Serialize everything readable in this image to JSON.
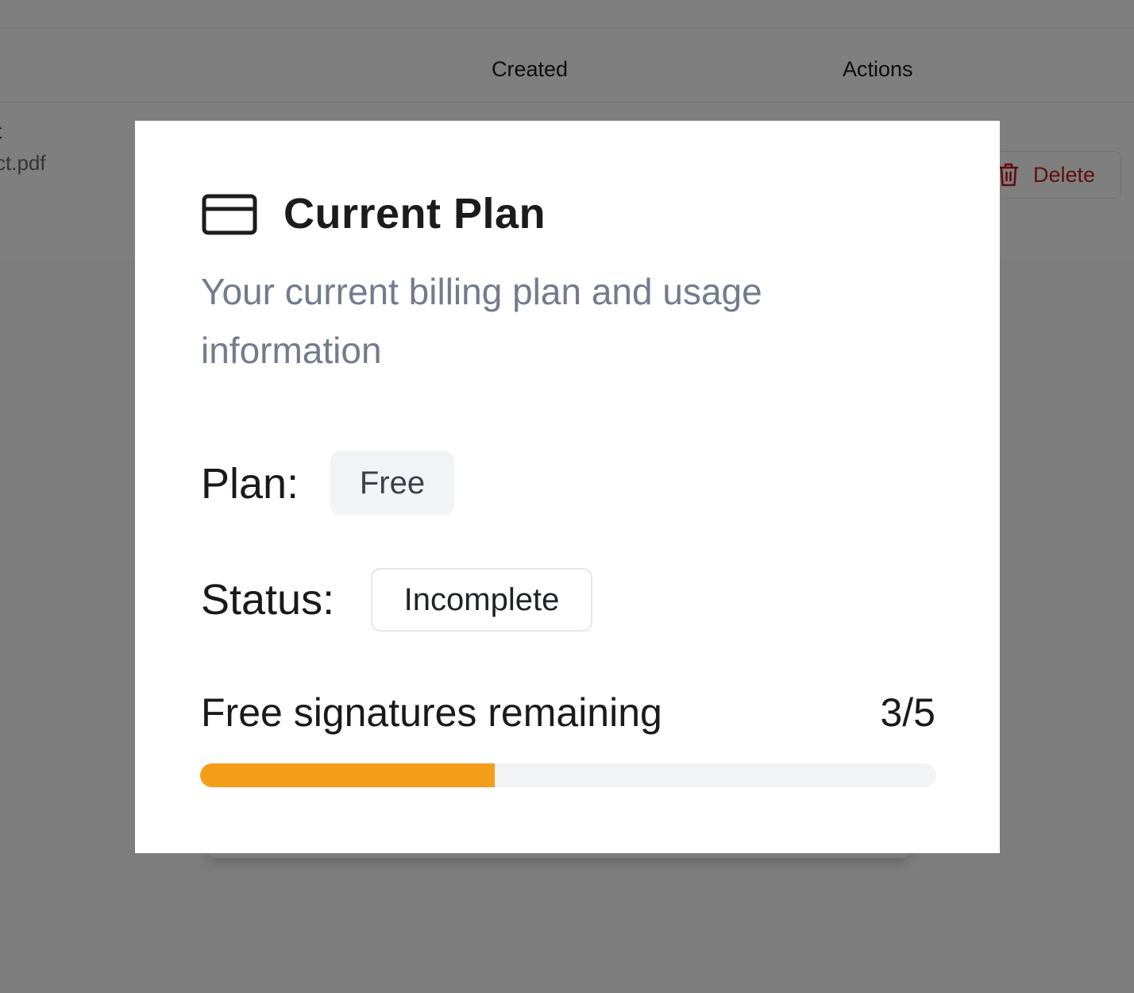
{
  "background": {
    "table": {
      "columns": [
        "Created",
        "Actions"
      ],
      "row": {
        "name": "ct",
        "file": "ct.pdf",
        "delete_label": "Delete"
      }
    }
  },
  "modal": {
    "icon": "credit-card-icon",
    "title": "Current Plan",
    "subtitle": "Your current billing plan and usage information",
    "plan_label": "Plan:",
    "plan_value": "Free",
    "status_label": "Status:",
    "status_value": "Incomplete",
    "usage_label": "Free signatures remaining",
    "usage_count": "3/5",
    "usage_progress_fraction": 0.4
  },
  "colors": {
    "progress_fill": "#f39d1a",
    "progress_track": "#f2f3f5",
    "delete_red": "#c41d1d",
    "subtitle_gray": "#737b8c",
    "overlay": "rgba(0,0,0,0.5)"
  }
}
